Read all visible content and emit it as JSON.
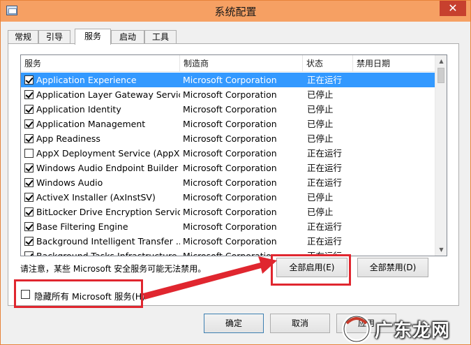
{
  "window": {
    "title": "系统配置"
  },
  "tabs": [
    "常规",
    "引导",
    "服务",
    "启动",
    "工具"
  ],
  "columns": [
    "服务",
    "制造商",
    "状态",
    "禁用日期"
  ],
  "services": [
    {
      "name": "Application Experience",
      "maker": "Microsoft Corporation",
      "status": "正在运行",
      "checked": true,
      "selected": true
    },
    {
      "name": "Application Layer Gateway Service",
      "maker": "Microsoft Corporation",
      "status": "已停止",
      "checked": true
    },
    {
      "name": "Application Identity",
      "maker": "Microsoft Corporation",
      "status": "已停止",
      "checked": true
    },
    {
      "name": "Application Management",
      "maker": "Microsoft Corporation",
      "status": "已停止",
      "checked": true
    },
    {
      "name": "App Readiness",
      "maker": "Microsoft Corporation",
      "status": "已停止",
      "checked": true
    },
    {
      "name": "AppX Deployment Service (AppX...",
      "maker": "Microsoft Corporation",
      "status": "正在运行",
      "checked": false
    },
    {
      "name": "Windows Audio Endpoint Builder",
      "maker": "Microsoft Corporation",
      "status": "正在运行",
      "checked": true
    },
    {
      "name": "Windows Audio",
      "maker": "Microsoft Corporation",
      "status": "正在运行",
      "checked": true
    },
    {
      "name": "ActiveX Installer (AxInstSV)",
      "maker": "Microsoft Corporation",
      "status": "已停止",
      "checked": true
    },
    {
      "name": "BitLocker Drive Encryption Service",
      "maker": "Microsoft Corporation",
      "status": "已停止",
      "checked": true
    },
    {
      "name": "Base Filtering Engine",
      "maker": "Microsoft Corporation",
      "status": "正在运行",
      "checked": true
    },
    {
      "name": "Background Intelligent Transfer ...",
      "maker": "Microsoft Corporation",
      "status": "正在运行",
      "checked": true
    },
    {
      "name": "Background Tasks Infrastructure ...",
      "maker": "Microsoft Corporation",
      "status": "正在运行",
      "checked": true
    }
  ],
  "note": "请注意，某些 Microsoft 安全服务可能无法禁用。",
  "enable_all": "全部启用(E)",
  "disable_all": "全部禁用(D)",
  "hide_ms": "隐藏所有 Microsoft 服务(H)",
  "ok": "确定",
  "cancel": "取消",
  "apply": "应用",
  "watermark": "广东龙网"
}
